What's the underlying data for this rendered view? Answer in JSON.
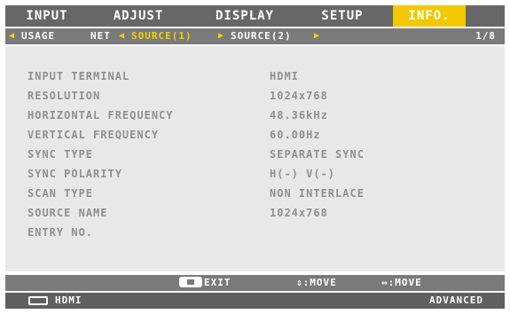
{
  "tabs": [
    {
      "label": "INPUT"
    },
    {
      "label": "ADJUST"
    },
    {
      "label": "DISPLAY"
    },
    {
      "label": "SETUP"
    },
    {
      "label": "INFO."
    }
  ],
  "subnav": {
    "items": [
      "USAGE",
      "NET",
      "SOURCE(1)",
      "SOURCE(2)"
    ],
    "pager": "1/8"
  },
  "info_rows": [
    {
      "label": "INPUT TERMINAL",
      "value": "HDMI"
    },
    {
      "label": "RESOLUTION",
      "value": "1024x768"
    },
    {
      "label": "HORIZONTAL FREQUENCY",
      "value": "48.36kHz"
    },
    {
      "label": "VERTICAL FREQUENCY",
      "value": "60.00Hz"
    },
    {
      "label": "SYNC TYPE",
      "value": "SEPARATE SYNC"
    },
    {
      "label": "SYNC POLARITY",
      "value": "H(-) V(-)"
    },
    {
      "label": "SCAN TYPE",
      "value": "NON INTERLACE"
    },
    {
      "label": "SOURCE NAME",
      "value": "1024x768"
    },
    {
      "label": "ENTRY NO.",
      "value": ""
    }
  ],
  "guide": {
    "exit": "EXIT",
    "move_updown": ":MOVE",
    "move_leftright": ":MOVE"
  },
  "status": {
    "input_name": "HDMI",
    "mode": "ADVANCED"
  }
}
